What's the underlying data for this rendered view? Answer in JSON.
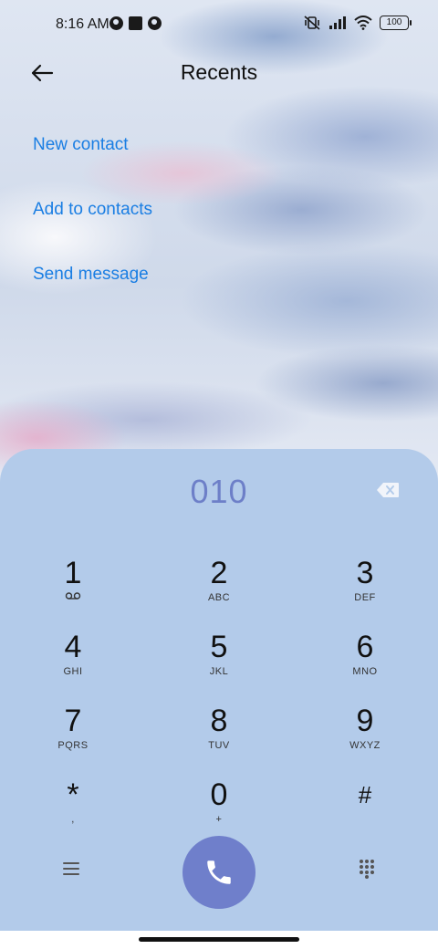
{
  "status_bar": {
    "time": "8:16 AM",
    "battery": "100"
  },
  "header": {
    "title": "Recents"
  },
  "actions": {
    "new_contact": "New contact",
    "add_to_contacts": "Add to contacts",
    "send_message": "Send message"
  },
  "dialpad": {
    "number": "010",
    "keys": [
      {
        "digit": "1",
        "letters": ""
      },
      {
        "digit": "2",
        "letters": "ABC"
      },
      {
        "digit": "3",
        "letters": "DEF"
      },
      {
        "digit": "4",
        "letters": "GHI"
      },
      {
        "digit": "5",
        "letters": "JKL"
      },
      {
        "digit": "6",
        "letters": "MNO"
      },
      {
        "digit": "7",
        "letters": "PQRS"
      },
      {
        "digit": "8",
        "letters": "TUV"
      },
      {
        "digit": "9",
        "letters": "WXYZ"
      },
      {
        "digit": "*",
        "letters": ","
      },
      {
        "digit": "0",
        "letters": "+"
      },
      {
        "digit": "#",
        "letters": ""
      }
    ]
  },
  "colors": {
    "accent_link": "#1a7ee3",
    "dialpad_bg": "#b3cbea",
    "number_text": "#6d7fc8",
    "call_button": "#6f7fcb"
  },
  "icons": {
    "back": "arrow-left-icon",
    "backspace": "backspace-icon",
    "voicemail": "voicemail-icon",
    "menu": "menu-icon",
    "call": "phone-icon",
    "keypad": "dialpad-icon"
  }
}
